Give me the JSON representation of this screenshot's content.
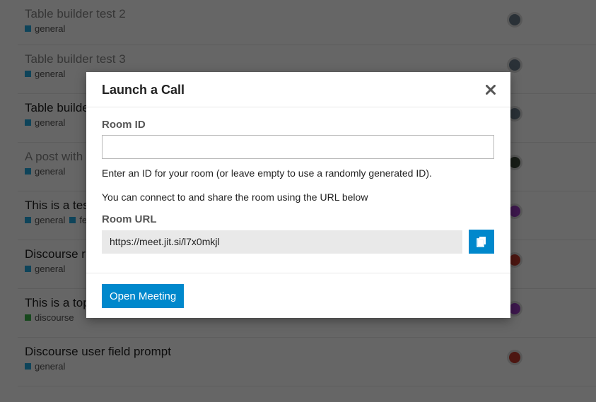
{
  "topics": [
    {
      "title": "Table builder test 2",
      "visited": true,
      "categories": [
        {
          "name": "general",
          "color": "#25aae1"
        }
      ],
      "avatar_color": "#6a7b8a"
    },
    {
      "title": "Table builder test 3",
      "visited": true,
      "categories": [
        {
          "name": "general",
          "color": "#25aae1"
        }
      ],
      "avatar_color": "#6a7b8a"
    },
    {
      "title": "Table builder test",
      "visited": false,
      "categories": [
        {
          "name": "general",
          "color": "#25aae1"
        }
      ],
      "avatar_color": "#6a7b8a"
    },
    {
      "title": "A post with",
      "visited": true,
      "categories": [
        {
          "name": "general",
          "color": "#25aae1"
        }
      ],
      "avatar_color": "#3d4a3a"
    },
    {
      "title": "This is a test",
      "visited": false,
      "categories": [
        {
          "name": "general",
          "color": "#25aae1"
        },
        {
          "name": "feat",
          "color": "#25aae1"
        }
      ],
      "avatar_color": "#9b3cc4"
    },
    {
      "title": "Discourse r",
      "visited": false,
      "categories": [
        {
          "name": "general",
          "color": "#25aae1"
        }
      ],
      "avatar_color": "#c0392b"
    },
    {
      "title": "This is a top",
      "visited": false,
      "categories": [
        {
          "name": "discourse",
          "color": "#3ab54a"
        }
      ],
      "avatar_color": "#9b3cc4"
    },
    {
      "title": "Discourse user field prompt",
      "visited": false,
      "categories": [
        {
          "name": "general",
          "color": "#25aae1"
        }
      ],
      "avatar_color": "#c0392b"
    }
  ],
  "modal": {
    "title": "Launch a Call",
    "room_id_label": "Room ID",
    "room_id_value": "",
    "room_id_help": "Enter an ID for your room (or leave empty to use a randomly generated ID).",
    "share_help": "You can connect to and share the room using the URL below",
    "room_url_label": "Room URL",
    "room_url": "https://meet.jit.si/l7x0mkjl",
    "open_button_label": "Open Meeting"
  },
  "colors": {
    "primary": "#0088cc",
    "overlay": "rgba(0,0,0,0.6)"
  },
  "icons": {
    "close": "close-icon",
    "copy": "copy-icon"
  }
}
